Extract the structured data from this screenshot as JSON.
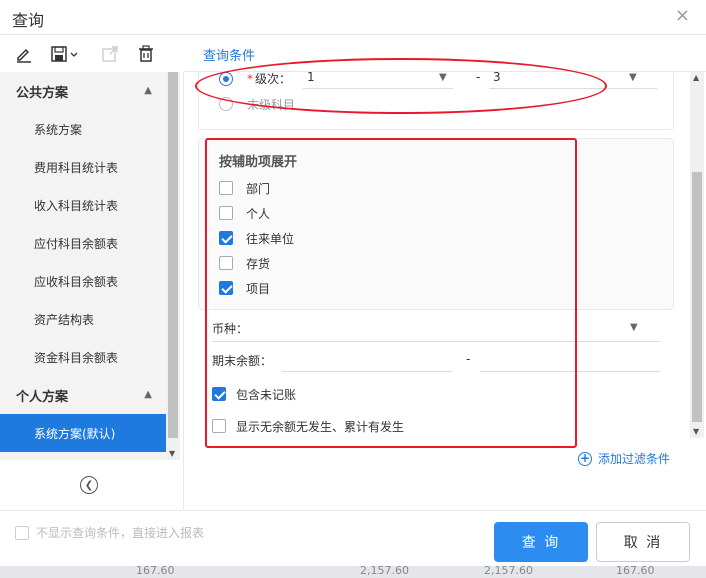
{
  "dialog": {
    "title": "查询",
    "close_glyph": "×"
  },
  "toolbar": {
    "icons": [
      "edit-icon",
      "save-icon",
      "share-icon",
      "delete-icon"
    ]
  },
  "sidebar": {
    "groups": [
      {
        "title": "公共方案",
        "items": [
          "系统方案",
          "费用科目统计表",
          "收入科目统计表",
          "应付科目余额表",
          "应收科目余额表",
          "资产结构表",
          "资金科目余额表"
        ]
      },
      {
        "title": "个人方案",
        "items": [
          "系统方案(默认)"
        ]
      }
    ],
    "active_item": "系统方案(默认)"
  },
  "tab": {
    "label": "查询条件"
  },
  "level": {
    "required_mark": "*",
    "label": "级次：",
    "from": "1",
    "dash": "-",
    "to": "3",
    "leaf_label": "末级科目"
  },
  "aux": {
    "title": "按辅助项展开",
    "options": [
      {
        "label": "部门",
        "checked": false
      },
      {
        "label": "个人",
        "checked": false
      },
      {
        "label": "往来单位",
        "checked": true
      },
      {
        "label": "存货",
        "checked": false
      },
      {
        "label": "项目",
        "checked": true
      }
    ]
  },
  "currency": {
    "label": "币种："
  },
  "balance": {
    "label": "期末余额：",
    "dash": "-"
  },
  "options": {
    "include_unposted": {
      "label": "包含未记账",
      "checked": true
    },
    "show_no_balance": {
      "label": "显示无余额无发生、累计有发生",
      "checked": false
    }
  },
  "add_filter": {
    "label": "添加过滤条件"
  },
  "footer": {
    "skip_label": "不显示查询条件，直接进入报表",
    "query_button": "查 询",
    "cancel_button": "取 消"
  },
  "background_values": [
    "167.60",
    "2,157.60",
    "2,157.60",
    "167.60"
  ],
  "colors": {
    "accent": "#1f7ae0",
    "primary_button": "#2d8cf0",
    "annotation": "#e8192c"
  }
}
